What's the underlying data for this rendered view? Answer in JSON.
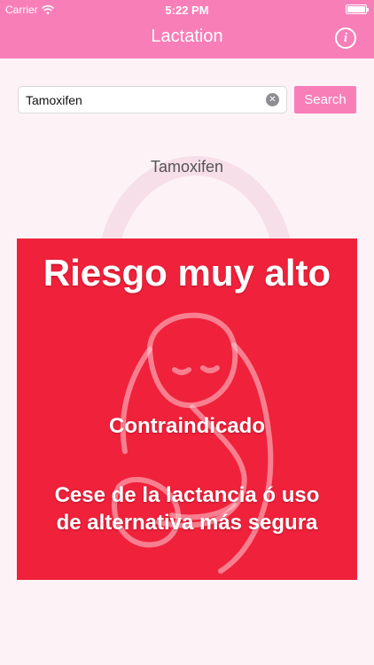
{
  "status_bar": {
    "carrier": "Carrier",
    "time": "5:22 PM"
  },
  "nav": {
    "title": "Lactation",
    "info_label": "i"
  },
  "search": {
    "value": "Tamoxifen",
    "button_label": "Search"
  },
  "result": {
    "drug_name": "Tamoxifen",
    "risk_level": "Riesgo muy alto",
    "status": "Contraindicado",
    "advice": "Cese de la lactancia ó uso de alternativa más segura"
  },
  "colors": {
    "brand_pink": "#f87eb8",
    "risk_red": "#f0213b",
    "background": "#fdf3f7"
  },
  "icons": [
    "wifi-icon",
    "battery-icon",
    "info-icon",
    "clear-icon",
    "mother-child-icon"
  ]
}
